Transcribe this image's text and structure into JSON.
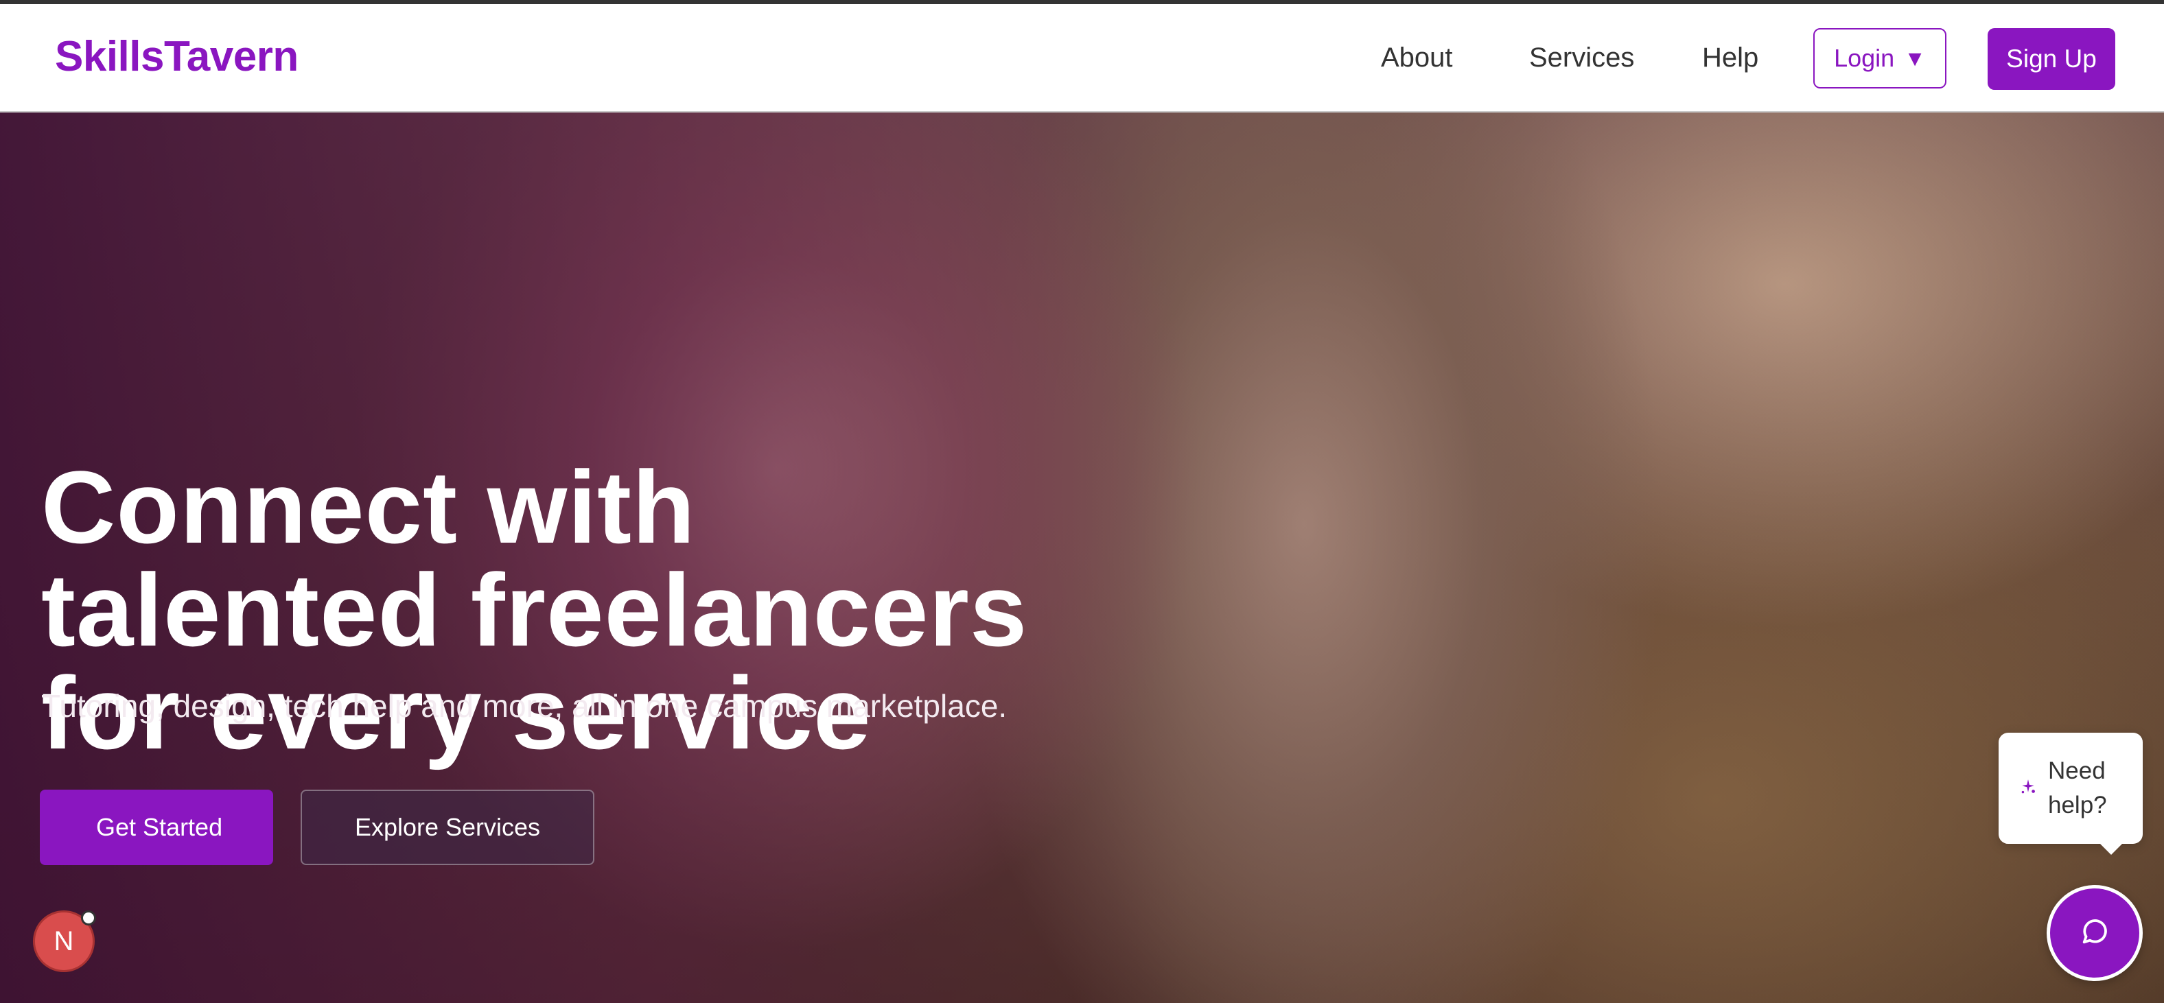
{
  "brand": {
    "name": "SkillsTavern",
    "color": "#8a16c0"
  },
  "nav": {
    "links": [
      {
        "label": "About"
      },
      {
        "label": "Services"
      },
      {
        "label": "Help"
      }
    ],
    "login_label": "Login",
    "login_caret": "▼",
    "signup_label": "Sign Up"
  },
  "hero": {
    "title_lines": [
      "Connect with",
      "talented freelancers",
      "for every service"
    ],
    "subtitle": "Tutoring, design, tech help and more, all in one campus marketplace.",
    "primary_cta": "Get Started",
    "secondary_cta": "Explore Services"
  },
  "avatar": {
    "initial": "N"
  },
  "help_widget": {
    "text": "Need help?",
    "icon": "sparkle-icon",
    "chat_icon": "chat-bubble-icon"
  }
}
